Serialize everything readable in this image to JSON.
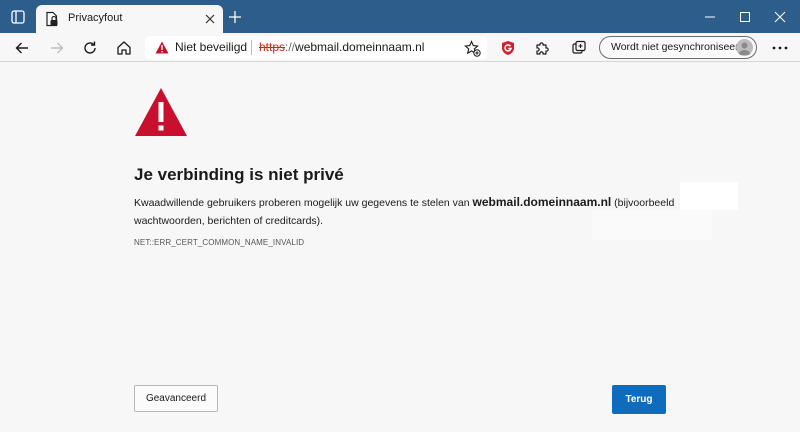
{
  "browser": {
    "tab": {
      "title": "Privacyfout"
    },
    "address_bar": {
      "security_label": "Niet beveiligd",
      "url_scheme": "https",
      "url_separator": "://",
      "url_host": "webmail.domeinnaam.nl"
    },
    "sync_button_label": "Wordt niet gesynchroniseerd",
    "icons": {
      "window_menu": "window-menu-icon",
      "tab_favicon": "file-lock-icon",
      "tab_close": "close-icon",
      "new_tab": "plus-icon",
      "minimize": "minimize-icon",
      "maximize": "maximize-icon",
      "close_window": "close-window-icon",
      "back": "back-arrow-icon",
      "forward": "forward-arrow-icon",
      "refresh": "refresh-icon",
      "home": "home-icon",
      "security_warning": "warning-triangle-icon",
      "favorites": "star-add-icon",
      "extension_shield": "shield-extension-icon",
      "extensions": "puzzle-icon",
      "collections": "collections-icon",
      "profile": "avatar-icon",
      "more": "more-dots-icon"
    }
  },
  "page": {
    "warning_icon": "warning-triangle-icon",
    "heading": "Je verbinding is niet privé",
    "description_before": "Kwaadwillende gebruikers proberen mogelijk uw gegevens te stelen van ",
    "description_host": "webmail.domeinnaam.nl",
    "description_after": " (bijvoorbeeld wachtwoorden, berichten of creditcards).",
    "error_code": "NET::ERR_CERT_COMMON_NAME_INVALID",
    "advanced_button": "Geavanceerd",
    "back_button": "Terug"
  },
  "colors": {
    "titlebar": "#2c5d8b",
    "page_background": "#f7f7f7",
    "warning_red": "#c8102e",
    "primary_button": "#0f6cbd",
    "insecure_scheme": "#c42b1c"
  }
}
